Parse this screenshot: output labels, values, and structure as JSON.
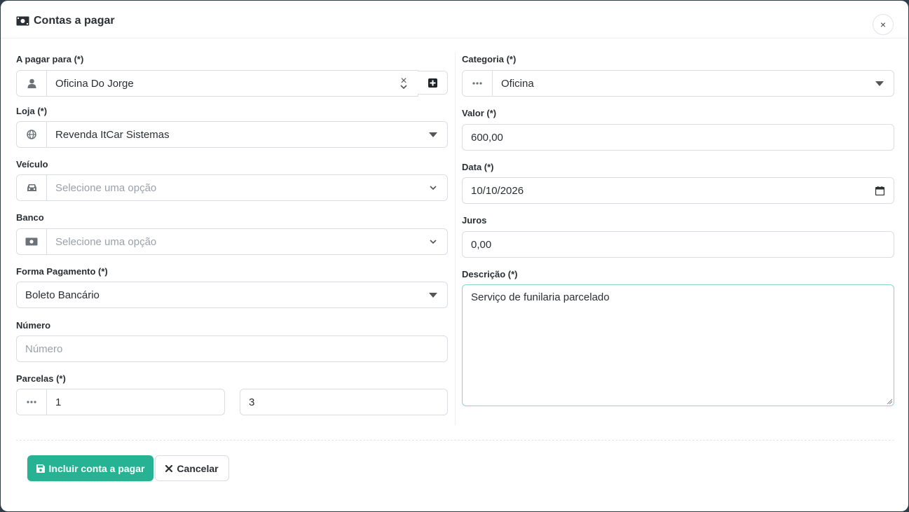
{
  "modal": {
    "title": "Contas a pagar",
    "close_label": "×"
  },
  "left": {
    "pagar_para": {
      "label": "A pagar para (*)",
      "value": "Oficina Do Jorge",
      "clear": "×"
    },
    "loja": {
      "label": "Loja (*)",
      "value": "Revenda ItCar Sistemas"
    },
    "veiculo": {
      "label": "Veículo",
      "placeholder": "Selecione uma opção"
    },
    "banco": {
      "label": "Banco",
      "placeholder": "Selecione uma opção"
    },
    "forma_pagamento": {
      "label": "Forma Pagamento (*)",
      "value": "Boleto Bancário"
    },
    "numero": {
      "label": "Número",
      "placeholder": "Número"
    },
    "parcelas": {
      "label": "Parcelas (*)",
      "value_from": "1",
      "value_to": "3"
    }
  },
  "right": {
    "categoria": {
      "label": "Categoria (*)",
      "value": "Oficina"
    },
    "valor": {
      "label": "Valor (*)",
      "value": "600,00"
    },
    "data": {
      "label": "Data (*)",
      "value": "10/10/2026"
    },
    "juros": {
      "label": "Juros",
      "value": "0,00"
    },
    "descricao": {
      "label": "Descrição (*)",
      "value": "Serviço de funilaria parcelado"
    }
  },
  "actions": {
    "submit_label": "Incluir conta a pagar",
    "cancel_label": "Cancelar"
  },
  "colors": {
    "primary": "#26b394",
    "border": "#d9dde2",
    "focus_border": "#8fd3c5"
  }
}
